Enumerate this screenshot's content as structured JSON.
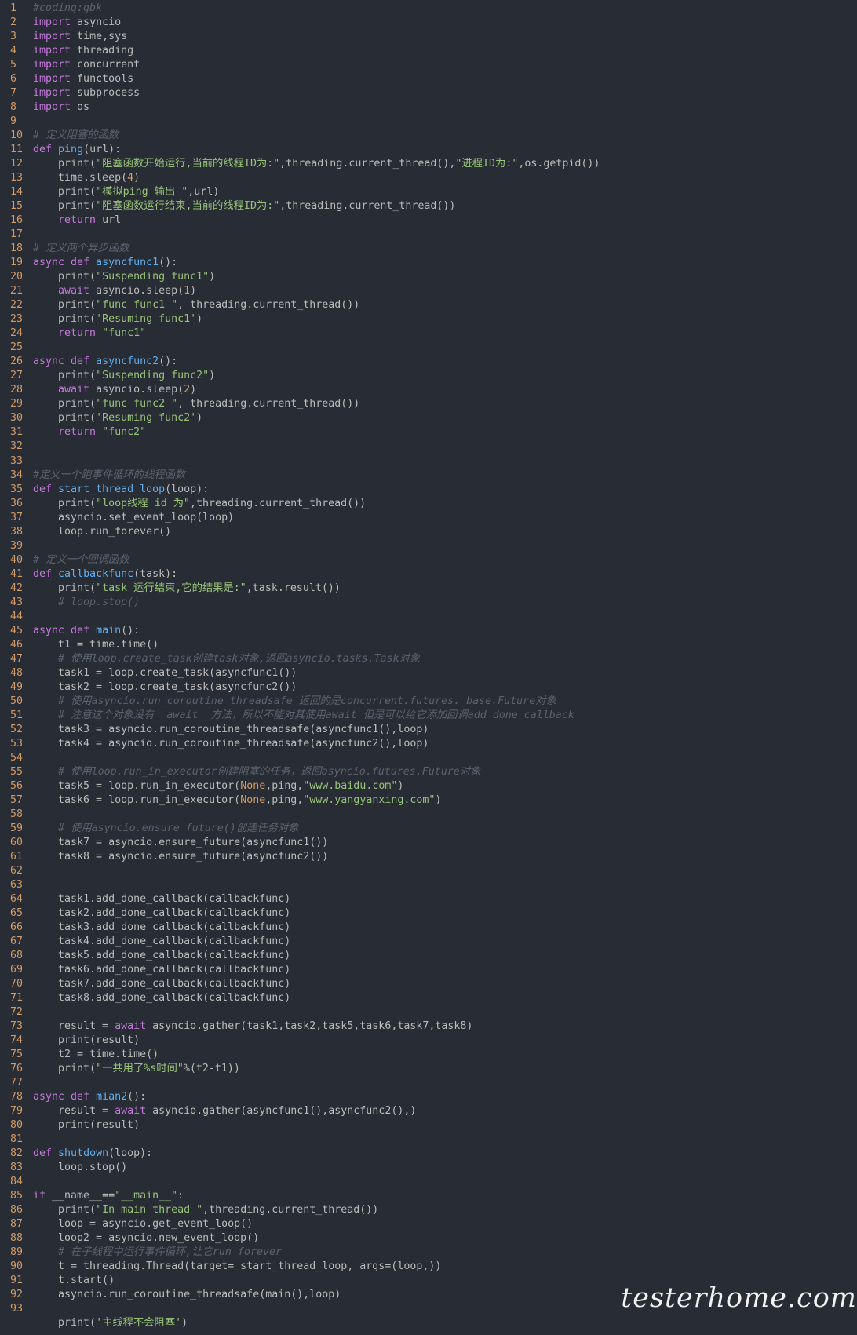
{
  "watermark": "testerhome.com",
  "colors": {
    "background": "#282c34",
    "keyword": "#c678dd",
    "function_name": "#61afef",
    "string": "#98c379",
    "number": "#d19a66",
    "comment": "#5c6370",
    "plain": "#bbbbbb",
    "line_number": "#d19a66"
  },
  "lines": [
    {
      "n": "1",
      "t": [
        [
          "c",
          "#coding:gbk"
        ]
      ]
    },
    {
      "n": "2",
      "t": [
        [
          "k",
          "import"
        ],
        [
          "p",
          " asyncio"
        ]
      ]
    },
    {
      "n": "3",
      "t": [
        [
          "k",
          "import"
        ],
        [
          "p",
          " time,sys"
        ]
      ]
    },
    {
      "n": "4",
      "t": [
        [
          "k",
          "import"
        ],
        [
          "p",
          " threading"
        ]
      ]
    },
    {
      "n": "5",
      "t": [
        [
          "k",
          "import"
        ],
        [
          "p",
          " concurrent"
        ]
      ]
    },
    {
      "n": "6",
      "t": [
        [
          "k",
          "import"
        ],
        [
          "p",
          " functools"
        ]
      ]
    },
    {
      "n": "7",
      "t": [
        [
          "k",
          "import"
        ],
        [
          "p",
          " subprocess"
        ]
      ]
    },
    {
      "n": "8",
      "t": [
        [
          "k",
          "import"
        ],
        [
          "p",
          " os"
        ]
      ]
    },
    {
      "n": "9",
      "t": []
    },
    {
      "n": "10",
      "t": [
        [
          "c",
          "# 定义阻塞的函数"
        ]
      ]
    },
    {
      "n": "11",
      "t": [
        [
          "k",
          "def"
        ],
        [
          "p",
          " "
        ],
        [
          "f",
          "ping"
        ],
        [
          "p",
          "(url):"
        ]
      ]
    },
    {
      "n": "12",
      "t": [
        [
          "p",
          "    print("
        ],
        [
          "s",
          "\"阻塞函数开始运行,当前的线程ID为:\""
        ],
        [
          "p",
          ",threading.current_thread(),"
        ],
        [
          "s",
          "\"进程ID为:\""
        ],
        [
          "p",
          ",os.getpid())"
        ]
      ]
    },
    {
      "n": "13",
      "t": [
        [
          "p",
          "    time.sleep("
        ],
        [
          "n",
          "4"
        ],
        [
          "p",
          ")"
        ]
      ]
    },
    {
      "n": "14",
      "t": [
        [
          "p",
          "    print("
        ],
        [
          "s",
          "\"模拟ping 输出 \""
        ],
        [
          "p",
          ",url)"
        ]
      ]
    },
    {
      "n": "15",
      "t": [
        [
          "p",
          "    print("
        ],
        [
          "s",
          "\"阻塞函数运行结束,当前的线程ID为:\""
        ],
        [
          "p",
          ",threading.current_thread())"
        ]
      ]
    },
    {
      "n": "16",
      "t": [
        [
          "p",
          "    "
        ],
        [
          "k",
          "return"
        ],
        [
          "p",
          " url"
        ]
      ]
    },
    {
      "n": "17",
      "t": []
    },
    {
      "n": "18",
      "t": [
        [
          "c",
          "# 定义两个异步函数"
        ]
      ]
    },
    {
      "n": "19",
      "t": [
        [
          "k",
          "async"
        ],
        [
          "p",
          " "
        ],
        [
          "k",
          "def"
        ],
        [
          "p",
          " "
        ],
        [
          "f",
          "asyncfunc1"
        ],
        [
          "p",
          "():"
        ]
      ]
    },
    {
      "n": "20",
      "t": [
        [
          "p",
          "    print("
        ],
        [
          "s",
          "\"Suspending func1\""
        ],
        [
          "p",
          ")"
        ]
      ]
    },
    {
      "n": "21",
      "t": [
        [
          "p",
          "    "
        ],
        [
          "k",
          "await"
        ],
        [
          "p",
          " asyncio.sleep("
        ],
        [
          "n",
          "1"
        ],
        [
          "p",
          ")"
        ]
      ]
    },
    {
      "n": "22",
      "t": [
        [
          "p",
          "    print("
        ],
        [
          "s",
          "\"func func1 \""
        ],
        [
          "p",
          ", threading.current_thread())"
        ]
      ]
    },
    {
      "n": "23",
      "t": [
        [
          "p",
          "    print("
        ],
        [
          "s",
          "'Resuming func1'"
        ],
        [
          "p",
          ")"
        ]
      ]
    },
    {
      "n": "24",
      "t": [
        [
          "p",
          "    "
        ],
        [
          "k",
          "return"
        ],
        [
          "p",
          " "
        ],
        [
          "s",
          "\"func1\""
        ]
      ]
    },
    {
      "n": "25",
      "t": []
    },
    {
      "n": "26",
      "t": [
        [
          "k",
          "async"
        ],
        [
          "p",
          " "
        ],
        [
          "k",
          "def"
        ],
        [
          "p",
          " "
        ],
        [
          "f",
          "asyncfunc2"
        ],
        [
          "p",
          "():"
        ]
      ]
    },
    {
      "n": "27",
      "t": [
        [
          "p",
          "    print("
        ],
        [
          "s",
          "\"Suspending func2\""
        ],
        [
          "p",
          ")"
        ]
      ]
    },
    {
      "n": "28",
      "t": [
        [
          "p",
          "    "
        ],
        [
          "k",
          "await"
        ],
        [
          "p",
          " asyncio.sleep("
        ],
        [
          "n",
          "2"
        ],
        [
          "p",
          ")"
        ]
      ]
    },
    {
      "n": "29",
      "t": [
        [
          "p",
          "    print("
        ],
        [
          "s",
          "\"func func2 \""
        ],
        [
          "p",
          ", threading.current_thread())"
        ]
      ]
    },
    {
      "n": "30",
      "t": [
        [
          "p",
          "    print("
        ],
        [
          "s",
          "'Resuming func2'"
        ],
        [
          "p",
          ")"
        ]
      ]
    },
    {
      "n": "31",
      "t": [
        [
          "p",
          "    "
        ],
        [
          "k",
          "return"
        ],
        [
          "p",
          " "
        ],
        [
          "s",
          "\"func2\""
        ]
      ]
    },
    {
      "n": "32",
      "t": []
    },
    {
      "n": "33",
      "t": []
    },
    {
      "n": "34",
      "t": [
        [
          "c",
          "#定义一个跑事件循环的线程函数"
        ]
      ]
    },
    {
      "n": "35",
      "t": [
        [
          "k",
          "def"
        ],
        [
          "p",
          " "
        ],
        [
          "f",
          "start_thread_loop"
        ],
        [
          "p",
          "(loop):"
        ]
      ]
    },
    {
      "n": "36",
      "t": [
        [
          "p",
          "    print("
        ],
        [
          "s",
          "\"loop线程 id 为\""
        ],
        [
          "p",
          ",threading.current_thread())"
        ]
      ]
    },
    {
      "n": "37",
      "t": [
        [
          "p",
          "    asyncio.set_event_loop(loop)"
        ]
      ]
    },
    {
      "n": "38",
      "t": [
        [
          "p",
          "    loop.run_forever()"
        ]
      ]
    },
    {
      "n": "39",
      "t": []
    },
    {
      "n": "40",
      "t": [
        [
          "c",
          "# 定义一个回调函数"
        ]
      ]
    },
    {
      "n": "41",
      "t": [
        [
          "k",
          "def"
        ],
        [
          "p",
          " "
        ],
        [
          "f",
          "callbackfunc"
        ],
        [
          "p",
          "(task):"
        ]
      ]
    },
    {
      "n": "42",
      "t": [
        [
          "p",
          "    print("
        ],
        [
          "s",
          "\"task 运行结束,它的结果是:\""
        ],
        [
          "p",
          ",task.result())"
        ]
      ]
    },
    {
      "n": "43",
      "t": [
        [
          "p",
          "    "
        ],
        [
          "c",
          "# loop.stop()"
        ]
      ]
    },
    {
      "n": "44",
      "t": []
    },
    {
      "n": "45",
      "t": [
        [
          "k",
          "async"
        ],
        [
          "p",
          " "
        ],
        [
          "k",
          "def"
        ],
        [
          "p",
          " "
        ],
        [
          "f",
          "main"
        ],
        [
          "p",
          "():"
        ]
      ]
    },
    {
      "n": "46",
      "t": [
        [
          "p",
          "    t1 = time.time()"
        ]
      ]
    },
    {
      "n": "47",
      "t": [
        [
          "p",
          "    "
        ],
        [
          "c",
          "# 使用loop.create_task创建task对象,返回asyncio.tasks.Task对象"
        ]
      ]
    },
    {
      "n": "48",
      "t": [
        [
          "p",
          "    task1 = loop.create_task(asyncfunc1())"
        ]
      ]
    },
    {
      "n": "49",
      "t": [
        [
          "p",
          "    task2 = loop.create_task(asyncfunc2())"
        ]
      ]
    },
    {
      "n": "50",
      "t": [
        [
          "p",
          "    "
        ],
        [
          "c",
          "# 使用asyncio.run_coroutine_threadsafe 返回的是concurrent.futures._base.Future对象"
        ]
      ]
    },
    {
      "n": "51",
      "t": [
        [
          "p",
          "    "
        ],
        [
          "c",
          "# 注意这个对象没有__await__方法，所以不能对其使用await 但是可以给它添加回调add_done_callback"
        ]
      ]
    },
    {
      "n": "52",
      "t": [
        [
          "p",
          "    task3 = asyncio.run_coroutine_threadsafe(asyncfunc1(),loop)"
        ]
      ]
    },
    {
      "n": "53",
      "t": [
        [
          "p",
          "    task4 = asyncio.run_coroutine_threadsafe(asyncfunc2(),loop)"
        ]
      ]
    },
    {
      "n": "54",
      "t": []
    },
    {
      "n": "55",
      "t": [
        [
          "p",
          "    "
        ],
        [
          "c",
          "# 使用loop.run_in_executor创建阻塞的任务，返回asyncio.futures.Future对象"
        ]
      ]
    },
    {
      "n": "56",
      "t": [
        [
          "p",
          "    task5 = loop.run_in_executor("
        ],
        [
          "n",
          "None"
        ],
        [
          "p",
          ",ping,"
        ],
        [
          "s",
          "\"www.baidu.com\""
        ],
        [
          "p",
          ")"
        ]
      ]
    },
    {
      "n": "57",
      "t": [
        [
          "p",
          "    task6 = loop.run_in_executor("
        ],
        [
          "n",
          "None"
        ],
        [
          "p",
          ",ping,"
        ],
        [
          "s",
          "\"www.yangyanxing.com\""
        ],
        [
          "p",
          ")"
        ]
      ]
    },
    {
      "n": "58",
      "t": []
    },
    {
      "n": "59",
      "t": [
        [
          "p",
          "    "
        ],
        [
          "c",
          "# 使用asyncio.ensure_future()创建任务对象"
        ]
      ]
    },
    {
      "n": "60",
      "t": [
        [
          "p",
          "    task7 = asyncio.ensure_future(asyncfunc1())"
        ]
      ]
    },
    {
      "n": "61",
      "t": [
        [
          "p",
          "    task8 = asyncio.ensure_future(asyncfunc2())"
        ]
      ]
    },
    {
      "n": "62",
      "t": []
    },
    {
      "n": "63",
      "t": []
    },
    {
      "n": "64",
      "t": [
        [
          "p",
          "    task1.add_done_callback(callbackfunc)"
        ]
      ]
    },
    {
      "n": "65",
      "t": [
        [
          "p",
          "    task2.add_done_callback(callbackfunc)"
        ]
      ]
    },
    {
      "n": "66",
      "t": [
        [
          "p",
          "    task3.add_done_callback(callbackfunc)"
        ]
      ]
    },
    {
      "n": "67",
      "t": [
        [
          "p",
          "    task4.add_done_callback(callbackfunc)"
        ]
      ]
    },
    {
      "n": "68",
      "t": [
        [
          "p",
          "    task5.add_done_callback(callbackfunc)"
        ]
      ]
    },
    {
      "n": "69",
      "t": [
        [
          "p",
          "    task6.add_done_callback(callbackfunc)"
        ]
      ]
    },
    {
      "n": "70",
      "t": [
        [
          "p",
          "    task7.add_done_callback(callbackfunc)"
        ]
      ]
    },
    {
      "n": "71",
      "t": [
        [
          "p",
          "    task8.add_done_callback(callbackfunc)"
        ]
      ]
    },
    {
      "n": "72",
      "t": []
    },
    {
      "n": "73",
      "t": [
        [
          "p",
          "    result = "
        ],
        [
          "k",
          "await"
        ],
        [
          "p",
          " asyncio.gather(task1,task2,task5,task6,task7,task8)"
        ]
      ]
    },
    {
      "n": "74",
      "t": [
        [
          "p",
          "    print(result)"
        ]
      ]
    },
    {
      "n": "75",
      "t": [
        [
          "p",
          "    t2 = time.time()"
        ]
      ]
    },
    {
      "n": "76",
      "t": [
        [
          "p",
          "    print("
        ],
        [
          "s",
          "\"一共用了%s时间\""
        ],
        [
          "p",
          "%(t2-t1))"
        ]
      ]
    },
    {
      "n": "77",
      "t": []
    },
    {
      "n": "78",
      "t": [
        [
          "k",
          "async"
        ],
        [
          "p",
          " "
        ],
        [
          "k",
          "def"
        ],
        [
          "p",
          " "
        ],
        [
          "f",
          "mian2"
        ],
        [
          "p",
          "():"
        ]
      ]
    },
    {
      "n": "79",
      "t": [
        [
          "p",
          "    result = "
        ],
        [
          "k",
          "await"
        ],
        [
          "p",
          " asyncio.gather(asyncfunc1(),asyncfunc2(),)"
        ]
      ]
    },
    {
      "n": "80",
      "t": [
        [
          "p",
          "    print(result)"
        ]
      ]
    },
    {
      "n": "81",
      "t": []
    },
    {
      "n": "82",
      "t": [
        [
          "k",
          "def"
        ],
        [
          "p",
          " "
        ],
        [
          "f",
          "shutdown"
        ],
        [
          "p",
          "(loop):"
        ]
      ]
    },
    {
      "n": "83",
      "t": [
        [
          "p",
          "    loop.stop()"
        ]
      ]
    },
    {
      "n": "84",
      "t": []
    },
    {
      "n": "85",
      "t": [
        [
          "k",
          "if"
        ],
        [
          "p",
          " __name__=="
        ],
        [
          "s",
          "\"__main__\""
        ],
        [
          "p",
          ":"
        ]
      ]
    },
    {
      "n": "86",
      "t": [
        [
          "p",
          "    print("
        ],
        [
          "s",
          "\"In main thread \""
        ],
        [
          "p",
          ",threading.current_thread())"
        ]
      ]
    },
    {
      "n": "87",
      "t": [
        [
          "p",
          "    loop = asyncio.get_event_loop()"
        ]
      ]
    },
    {
      "n": "88",
      "t": [
        [
          "p",
          "    loop2 = asyncio.new_event_loop()"
        ]
      ]
    },
    {
      "n": "89",
      "t": [
        [
          "p",
          "    "
        ],
        [
          "c",
          "# 在子线程中运行事件循环,让它run_forever"
        ]
      ]
    },
    {
      "n": "90",
      "t": [
        [
          "p",
          "    t = threading.Thread(target= start_thread_loop, args=(loop,))"
        ]
      ]
    },
    {
      "n": "91",
      "t": [
        [
          "p",
          "    t.start()"
        ]
      ]
    },
    {
      "n": "92",
      "t": [
        [
          "p",
          "    asyncio.run_coroutine_threadsafe(main(),loop)"
        ]
      ]
    },
    {
      "n": "93",
      "t": []
    },
    {
      "n": "",
      "t": [
        [
          "p",
          "    print("
        ],
        [
          "s",
          "'主线程不会阻塞'"
        ],
        [
          "p",
          ")"
        ]
      ]
    }
  ]
}
